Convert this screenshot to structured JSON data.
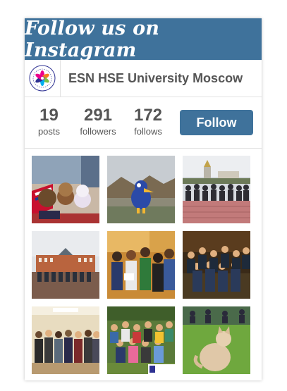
{
  "widget": {
    "title": "Follow us on Instagram",
    "username": "ESN HSE University Moscow",
    "stats": [
      {
        "value": "19",
        "label": "posts"
      },
      {
        "value": "291",
        "label": "followers"
      },
      {
        "value": "172",
        "label": "follows"
      }
    ],
    "follow_label": "Follow",
    "accent": "#3f729b"
  },
  "photos": [
    {
      "icon": "plush-toys-photo"
    },
    {
      "icon": "blue-bird-toy-photo"
    },
    {
      "icon": "group-monastery-photo"
    },
    {
      "icon": "group-palace-photo"
    },
    {
      "icon": "erasmus-students-photo"
    },
    {
      "icon": "party-crowd-photo"
    },
    {
      "icon": "classroom-group-photo"
    },
    {
      "icon": "park-group-photo"
    },
    {
      "icon": "cat-in-grass-photo"
    }
  ]
}
